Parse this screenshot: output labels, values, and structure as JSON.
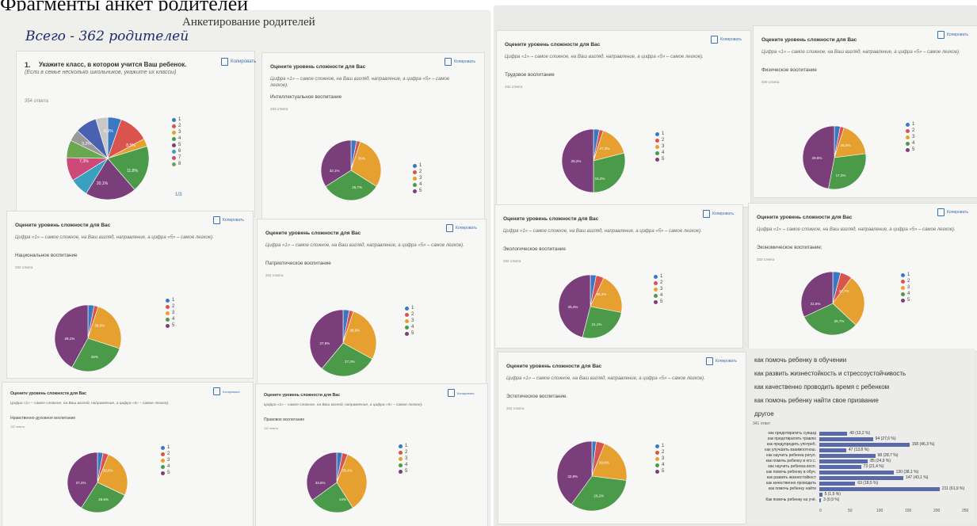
{
  "caption": "Фрагменты анкет родителей",
  "left": {
    "doc_title": "Анкетирование родителей",
    "handwritten_note": "Всего - 362 родителей",
    "q1": {
      "number": "1.",
      "title": "Укажите класс, в котором учится Ваш ребенок.",
      "hint": "(Если в семье несколько школьников, укажите их классы)",
      "count": "354 ответа",
      "copy": "Копировать",
      "legend": [
        "1",
        "2",
        "3",
        "4",
        "5",
        "6",
        "7",
        "8"
      ],
      "more": "1/3",
      "slices": [
        {
          "value": 5.3,
          "color": "#3a78c2"
        },
        {
          "value": 11.8,
          "color": "#d9534f"
        },
        {
          "value": 3.1,
          "color": "#e6a030"
        },
        {
          "value": 18.5,
          "color": "#4a9a4a"
        },
        {
          "value": 20.1,
          "color": "#7a3f7a"
        },
        {
          "value": 7.3,
          "color": "#3aa0c0"
        },
        {
          "value": 9.2,
          "color": "#cc4a78"
        },
        {
          "value": 6.9,
          "color": "#6aa84f"
        },
        {
          "value": 4.6,
          "color": "#999999"
        },
        {
          "value": 8.5,
          "color": "#4a60b0"
        },
        {
          "value": 4.7,
          "color": "#c8c8c8"
        }
      ],
      "labels": [
        "20,1%",
        "11,8%",
        "7,3%",
        "9,2%",
        "6,9%",
        "8,5%"
      ]
    },
    "cards": [
      {
        "title": "Оцените уровень сложности для Вас",
        "sub": "Цифра «1» – самое сложное, на Ваш взгляд, направление, а цифра «5» – самое легкое).",
        "cat": "Интеллектуальное воспитание",
        "count": "333 ответа",
        "copy": "Копировать",
        "legend": [
          "1",
          "2",
          "3",
          "4",
          "5"
        ],
        "labels": [
          "35%",
          "32,1%",
          "26,7%"
        ]
      },
      {
        "title": "Оцените уровень сложности для Вас",
        "sub": "Цифра «1» – самое сложное, на Ваш взгляд, направление, а цифра «5» – самое легкое).",
        "cat": "Национальное воспитание",
        "count": "332 ответа",
        "copy": "Копировать",
        "legend": [
          "1",
          "2",
          "3",
          "4",
          "5"
        ],
        "labels": [
          "38,6%",
          "28,1%",
          "25%"
        ]
      },
      {
        "title": "Оцените уровень сложности для Вас",
        "sub": "Цифра «1» – самое сложное, на Ваш взгляд, направление, а цифра «5» – самое легкое).",
        "cat": "Патриотическое воспитание",
        "count": "332 ответа",
        "copy": "Копировать",
        "legend": [
          "1",
          "2",
          "3",
          "4",
          "5"
        ],
        "labels": [
          "38,9%",
          "27,9%",
          "27,3%"
        ]
      },
      {
        "title": "Оцените уровень сложности для Вас",
        "sub": "Цифра «1» – самое сложное, на Ваш взгляд, направление, а цифра «5» – самое легкое).",
        "cat": "Нравственно-духовное воспитание",
        "count": "332 ответа",
        "copy": "Копировать",
        "legend": [
          "1",
          "2",
          "3",
          "4",
          "5"
        ],
        "labels": [
          "38,6%",
          "27,4%",
          "25,6%"
        ]
      },
      {
        "title": "Оцените уровень сложности для Вас",
        "sub": "Цифра «1» – самое сложное, на Ваш взгляд, направление, а цифра «5» – самое легкое).",
        "cat": "Правовое воспитание",
        "count": "332 ответа",
        "copy": "Копировать",
        "legend": [
          "1",
          "2",
          "3",
          "4",
          "5"
        ],
        "labels": [
          "35,4%",
          "34,6%",
          "24%"
        ]
      }
    ]
  },
  "right": {
    "cards": [
      {
        "title": "Оцените уровень сложности для Вас",
        "sub": "Цифра «1» – самое сложное, на Ваш взгляд, направление, а цифра «5» – самое легкое).",
        "cat": "Трудовое воспитание",
        "count": "332 ответа",
        "copy": "Копировать",
        "legend": [
          "1",
          "2",
          "3",
          "4",
          "5"
        ],
        "labels": [
          "47,3%",
          "29,2%",
          "16,3%"
        ]
      },
      {
        "title": "Оцените уровень сложности для Вас",
        "sub": "Цифра «1» – самое сложное, на Ваш взгляд, направление, а цифра «5» – самое легкое).",
        "cat": "Физическое воспитание",
        "count": "330 ответа",
        "copy": "Копировать",
        "legend": [
          "1",
          "2",
          "3",
          "4",
          "5"
        ],
        "labels": [
          "46,4%",
          "29,9%",
          "17,3%"
        ]
      },
      {
        "title": "Оцените уровень сложности для Вас",
        "sub": "Цифра «1» – самое сложное, на Ваш взгляд, направление, а цифра «5» – самое легкое).",
        "cat": "Экологическое воспитание",
        "count": "332 ответа",
        "copy": "Копировать",
        "legend": [
          "1",
          "2",
          "3",
          "4",
          "5"
        ],
        "labels": [
          "46,2%",
          "25,4%",
          "21,1%"
        ]
      },
      {
        "title": "Оцените уровень сложности для Вас",
        "sub": "Цифра «1» – самое сложное, на Ваш взгляд, направление, а цифра «5» – самое легкое).",
        "cat": "Экономическое воспитание;",
        "count": "333 ответа",
        "copy": "Копировать",
        "legend": [
          "1",
          "2",
          "3",
          "4",
          "5"
        ],
        "labels": [
          "31,7%",
          "31,5%",
          "26,7%"
        ]
      },
      {
        "title": "Оцените уровень сложности для Вас",
        "sub": "Цифра «1» – самое сложное, на Ваш взгляд, направление, а цифра «5» – самое легкое).",
        "cat": "Эстетическое воспитание.",
        "count": "332 ответа",
        "copy": "Копировать",
        "legend": [
          "1",
          "2",
          "3",
          "4",
          "5"
        ],
        "labels": [
          "39,8%",
          "32,8%",
          "20,2%"
        ]
      }
    ],
    "options": [
      "как помочь ребенку в обучении",
      "как развить жизнестойкость и стрессоустойчивость",
      "как качественно проводить время с ребенком",
      "как помочь ребенку найти свое призвание",
      "другое"
    ],
    "bars_count": "341 ответ",
    "bars_axis": [
      "0",
      "50",
      "100",
      "150",
      "200",
      "250"
    ]
  },
  "colors": {
    "c1": "#3a78c2",
    "c2": "#d9534f",
    "c3": "#e6a030",
    "c4": "#4a9a4a",
    "c5": "#7a3f7a"
  },
  "chart_data": {
    "type": "bar",
    "orientation": "horizontal",
    "count_label": "341 ответ",
    "xlim": [
      0,
      250
    ],
    "x_ticks": [
      0,
      50,
      100,
      150,
      200,
      250
    ],
    "categories": [
      "как предотвратить суицид",
      "как предотвратить травлю",
      "как предупредить употреб.",
      "как улучшить взаимоотнош.",
      "как научить ребенка регул.",
      "как помочь ребенку в его с.",
      "как научить ребенка восп.",
      "как помочь ребенку в обуч.",
      "как развить жизнестойкост",
      "как качественно проводить",
      "как помочь ребенку найти",
      "Как помочь ребенку на учё."
    ],
    "values": [
      49,
      94,
      158,
      47,
      98,
      85,
      73,
      130,
      147,
      63,
      211,
      3
    ],
    "extra": {
      "category": "",
      "value": 5
    },
    "value_labels": [
      "49 (13,2 %)",
      "94 (27,6 %)",
      "158 (46,3 %)",
      "47 (13,8 %)",
      "98 (28,7 %)",
      "85 (24,9 %)",
      "73 (21,4 %)",
      "130 (38,1 %)",
      "147 (43,1 %)",
      "63 (18,5 %)",
      "211 (61,9 %)",
      "3 (0,9 %)"
    ],
    "extra_label": "5 (1,5 %)"
  }
}
